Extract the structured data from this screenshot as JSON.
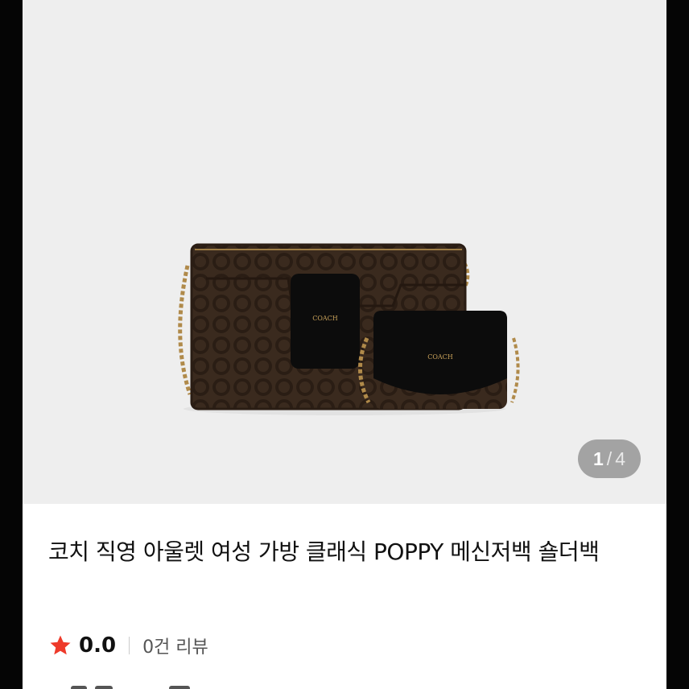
{
  "gallery": {
    "current_page": "1",
    "separator": "/",
    "total_pages": "4",
    "image_alt": "Coach Poppy crossbody bag with card case"
  },
  "product": {
    "title": "코치 직영 아울렛 여성 가방 클래식 POPPY 메신저백 숄더백",
    "rating": "0.0",
    "review_count": "0건 리뷰"
  },
  "colors": {
    "accent_star": "#ee3a2a",
    "gallery_bg": "#eeeeee",
    "indicator_bg": "#a3a3a3"
  },
  "icons": {
    "rating": "star-icon"
  }
}
